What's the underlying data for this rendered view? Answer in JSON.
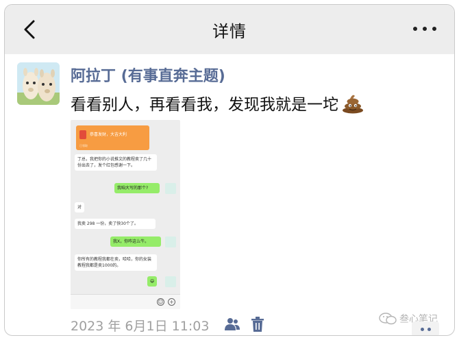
{
  "header": {
    "title": "详情",
    "back_icon": "chevron-left-icon",
    "more_icon": "more-horizontal-icon"
  },
  "post": {
    "author": "阿拉丁 (有事直奔主题)",
    "text": "看看别人，再看看我，发现我就是一坨",
    "emoji": "poop-icon",
    "date": "2023 年 6月1日 11:03"
  },
  "screenshot": {
    "redpack_text": "恭喜发财，大吉大利",
    "redpack_sub": "已领取",
    "messages": [
      {
        "side": "left",
        "text": "丁总，我把你的小说推文的教程卖了几十份出去了，发个红包感谢一下。"
      },
      {
        "side": "right",
        "text": "我咱大写的那个?"
      },
      {
        "side": "left",
        "text": "对"
      },
      {
        "side": "left",
        "text": "我卖 298 一份，卖了快30个了。"
      },
      {
        "side": "right",
        "text": "我X，你咋这么牛。"
      },
      {
        "side": "left",
        "text": "你所有的教程我都在卖，哈哈，你的女装教程我都是卖1000的。"
      },
      {
        "side": "right",
        "text": "😄"
      }
    ]
  },
  "watermark": "叁心笔记",
  "colors": {
    "name": "#576b95",
    "header_bg": "#ededed",
    "bubble_green": "#95ec69"
  }
}
